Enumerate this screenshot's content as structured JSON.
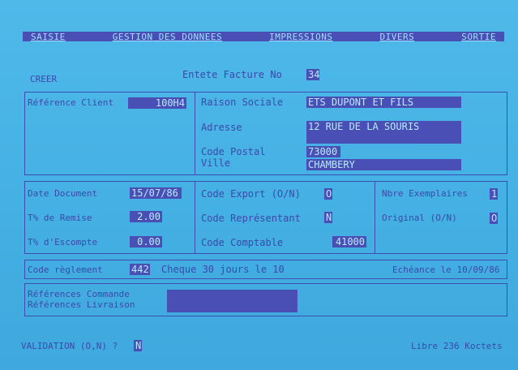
{
  "menu": {
    "items": [
      "SAISIE",
      "GESTION DES DONNEES",
      "IMPRESSIONS",
      "DIVERS",
      "SORTIE"
    ]
  },
  "mode_label": "CREER",
  "header": {
    "label": "Entete Facture No",
    "number": "34"
  },
  "client": {
    "ref_label": "Référence Client",
    "ref_value": "100H4",
    "raison_label": "Raison Sociale",
    "raison_value": "ETS DUPONT ET FILS",
    "adresse_label": "Adresse",
    "adresse_value": "12 RUE DE LA SOURIS",
    "cp_label": "Code Postal",
    "cp_value": "73000",
    "ville_label": "Ville",
    "ville_value": "CHAMBERY"
  },
  "doc": {
    "date_label": "Date Document",
    "date_value": "15/07/86",
    "remise_label": "T% de Remise",
    "remise_value": "2.00",
    "escompte_label": "T% d'Escompte",
    "escompte_value": "0.00",
    "export_label": "Code Export (O/N)",
    "export_value": "O",
    "representant_label": "Code Représentant",
    "representant_value": "N",
    "comptable_label": "Code Comptable",
    "comptable_value": "41000",
    "exemplaires_label": "Nbre Exemplaires",
    "exemplaires_value": "1",
    "original_label": "Original (O/N)",
    "original_value": "O"
  },
  "reglement": {
    "label": "Code règlement",
    "code": "442",
    "description": "Cheque 30 jours   le 10",
    "echeance": "Echéance le 10/09/86"
  },
  "references": {
    "commande_label": "Références Commande",
    "livraison_label": "Références Livraison",
    "value": ""
  },
  "footer": {
    "validation_label": "VALIDATION (O,N) ?",
    "validation_value": "N",
    "memory": "Libre 236 Koctets"
  }
}
